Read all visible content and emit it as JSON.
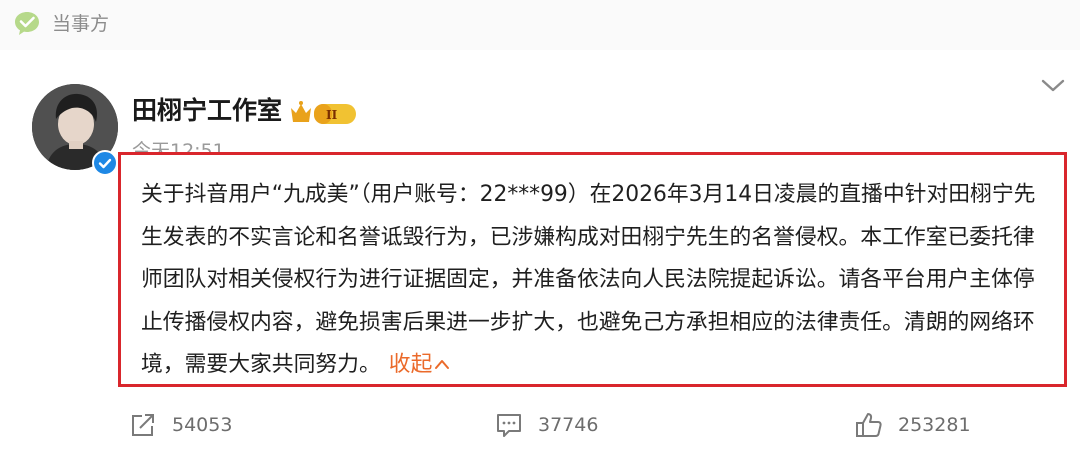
{
  "source": {
    "label": "当事方",
    "icon": "chat-bubble-icon"
  },
  "post": {
    "author": "田栩宁工作室",
    "badge": "II",
    "time": "今天12:51",
    "body": "关于抖音用户“九成美”（用户账号：22***99）在2026年3月14日凌晨的直播中针对田栩宁先生发表的不实言论和名誉诋毁行为，已涉嫌构成对田栩宁先生的名誉侵权。本工作室已委托律师团队对相关侵权行为进行证据固定，并准备依法向人民法院提起诉讼。请各平台用户主体停止传播侵权内容，避免损害后果进一步扩大，也避免己方承担相应的法律责任。清朗的网络环境，需要大家共同努力。",
    "collapse_label": "收起",
    "highlight_color": "#d9262c"
  },
  "actions": {
    "repost": {
      "count": "54053",
      "icon": "share-icon"
    },
    "comment": {
      "count": "37746",
      "icon": "comment-icon"
    },
    "like": {
      "count": "253281",
      "icon": "thumbs-up-icon"
    }
  }
}
